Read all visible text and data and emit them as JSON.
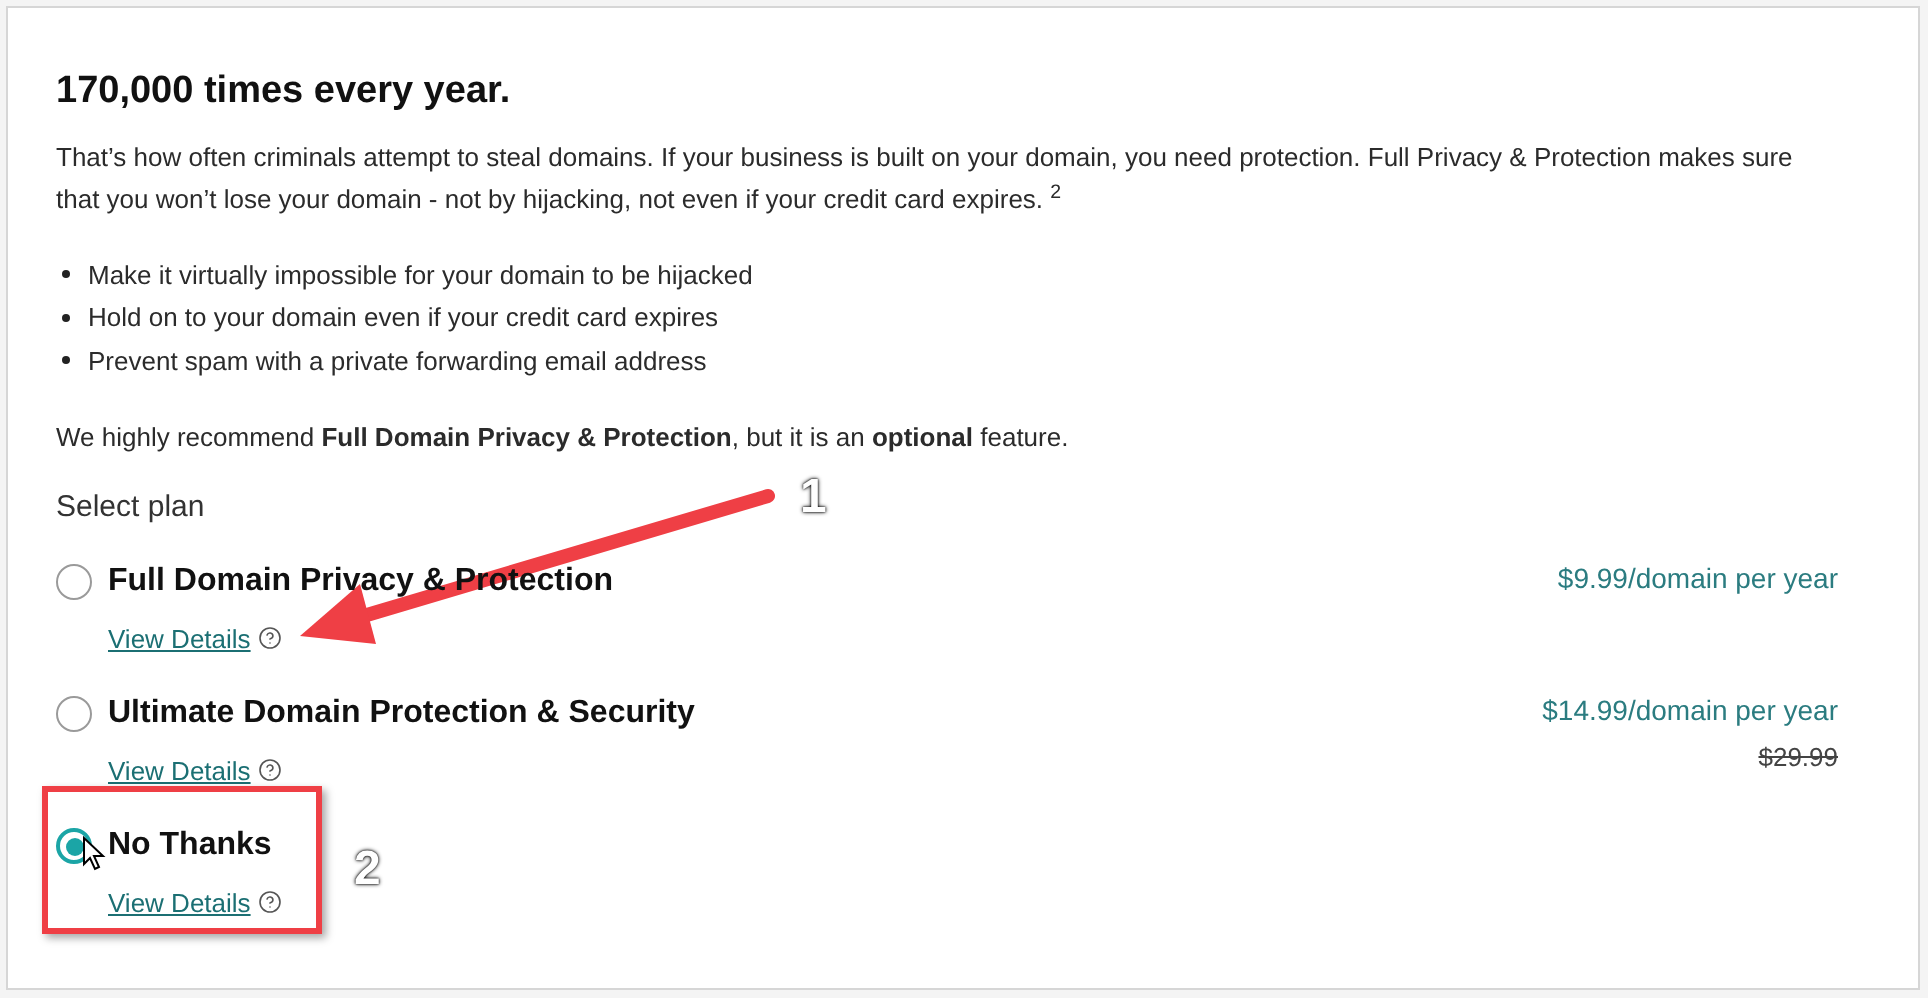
{
  "heading": "170,000 times every year.",
  "intro": "That’s how often criminals attempt to steal domains. If your business is built on your domain, you need protection. Full Privacy & Protection makes sure that you won’t lose your domain - not by hijacking, not even if your credit card expires. $^{2}$",
  "bullets": [
    "Make it virtually impossible for your domain to be hijacked",
    "Hold on to your domain even if your credit card expires",
    "Prevent spam with a private forwarding email address"
  ],
  "recommendation": "We highly recommend **Full Domain Privacy & Protection**, but it is an **optional** feature.",
  "select_label": "Select plan",
  "plans": [
    {
      "name": "Full Domain Privacy & Protection",
      "selected": false,
      "details_link": "View Details",
      "price": "$9.99/domain per year"
    },
    {
      "name": "Ultimate Domain Protection & Security",
      "selected": false,
      "details_link": "View Details",
      "price": "$14.99/domain per year",
      "old_price": "$29.99"
    },
    {
      "name": "No Thanks",
      "selected": true,
      "details_link": "View Details"
    }
  ],
  "annotations": [
    {
      "kind": "arrow",
      "label": "1"
    },
    {
      "kind": "box",
      "label": "2"
    }
  ]
}
